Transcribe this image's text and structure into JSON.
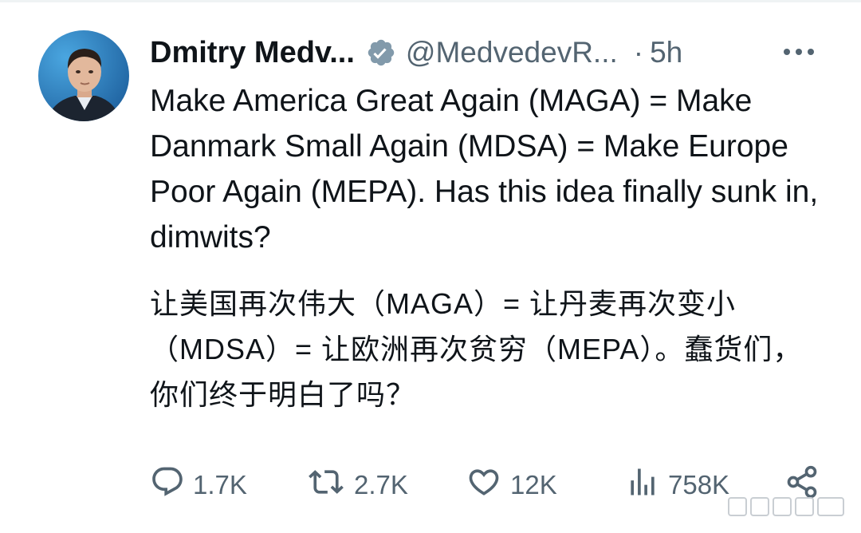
{
  "author": {
    "display_name": "Dmitry Medv...",
    "handle": "@MedvedevR...",
    "separator": "·",
    "time": "5h"
  },
  "tweet": {
    "text_en": "Make America Great Again (MAGA) = Make Danmark Small Again (MDSA) = Make Europe Poor Again (MEPA). Has this idea finally sunk in, dimwits?",
    "text_zh": "让美国再次伟大（MAGA）= 让丹麦再次变小（MDSA）= 让欧洲再次贫穷（MEPA）。蠢货们，你们终于明白了吗？"
  },
  "actions": {
    "replies": "1.7K",
    "retweets": "2.7K",
    "likes": "12K",
    "views": "758K"
  },
  "icons": {
    "verified": "verified-badge-icon",
    "more": "more-dots-icon",
    "reply": "reply-icon",
    "retweet": "retweet-icon",
    "like": "heart-icon",
    "views": "views-bar-icon",
    "share": "share-icon"
  },
  "colors": {
    "text": "#0f1419",
    "secondary": "#536471",
    "verified": "#829aab"
  }
}
